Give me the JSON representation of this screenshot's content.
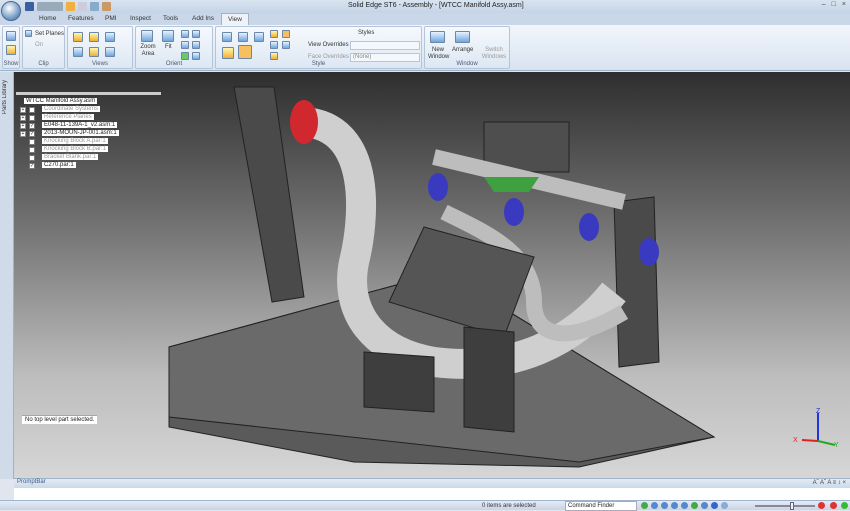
{
  "window": {
    "title": "Solid Edge ST6 - Assembly - [WTCC Manifold Assy.asm]"
  },
  "tabs": [
    {
      "label": "Home"
    },
    {
      "label": "Features"
    },
    {
      "label": "PMI"
    },
    {
      "label": "Inspect"
    },
    {
      "label": "Tools"
    },
    {
      "label": "Add Ins"
    },
    {
      "label": "View",
      "active": true
    }
  ],
  "ribbon": {
    "groups": {
      "show": "Show",
      "clip": "Clip",
      "views": "Views",
      "orient": "Orient",
      "style": "Style",
      "window": "Window"
    },
    "clip": {
      "set_planes": "Set Planes",
      "on": "On"
    },
    "orient": {
      "zoom_area": "Zoom Area",
      "fit": "Fit"
    },
    "style": {
      "styles": "Styles",
      "view_overrides": "View Overrides",
      "face_overrides": "Face Overrides",
      "view_overrides_value": "",
      "face_overrides_value": "(None)"
    },
    "window": {
      "new_window": "New Window",
      "arrange": "Arrange",
      "switch_windows": "Switch Windows"
    }
  },
  "side_tabs": {
    "parts_library": "Parts Library"
  },
  "tree": {
    "root": "WTCC Manifold Assy.asm",
    "items": [
      {
        "label": "Coordinate Systems",
        "checked": false,
        "expandable": true,
        "dim": true
      },
      {
        "label": "Reference Planes",
        "checked": false,
        "expandable": true,
        "dim": true
      },
      {
        "label": "E048-11-139A-1_v2.asm:1",
        "checked": true,
        "expandable": true,
        "dim": false
      },
      {
        "label": "2013-MOUN-JP-001.asm:1",
        "checked": true,
        "expandable": true,
        "dim": false
      },
      {
        "label": "Knocking Block A.par:1",
        "checked": false,
        "expandable": false,
        "dim": true
      },
      {
        "label": "Knocking Block B.par:1",
        "checked": false,
        "expandable": false,
        "dim": true
      },
      {
        "label": "Bracket Blank.par:1",
        "checked": false,
        "expandable": false,
        "dim": true
      },
      {
        "label": "C270.par:1",
        "checked": true,
        "expandable": false,
        "dim": false
      }
    ]
  },
  "viewport": {
    "message": "No top level part selected.",
    "triad": {
      "x": "X",
      "y": "Y",
      "z": "Z"
    }
  },
  "promptbar": {
    "title": "PromptBar",
    "tools": "Aˆ Aˇ A ≡ ↕ ×"
  },
  "status": {
    "selection": "0 items are selected",
    "command_finder": "Command Finder"
  },
  "colors": {
    "accent": "#f39a1c",
    "ribbon": "#dde7f3",
    "flange_red": "#d0282e",
    "flange_blue": "#3a3ac0"
  }
}
